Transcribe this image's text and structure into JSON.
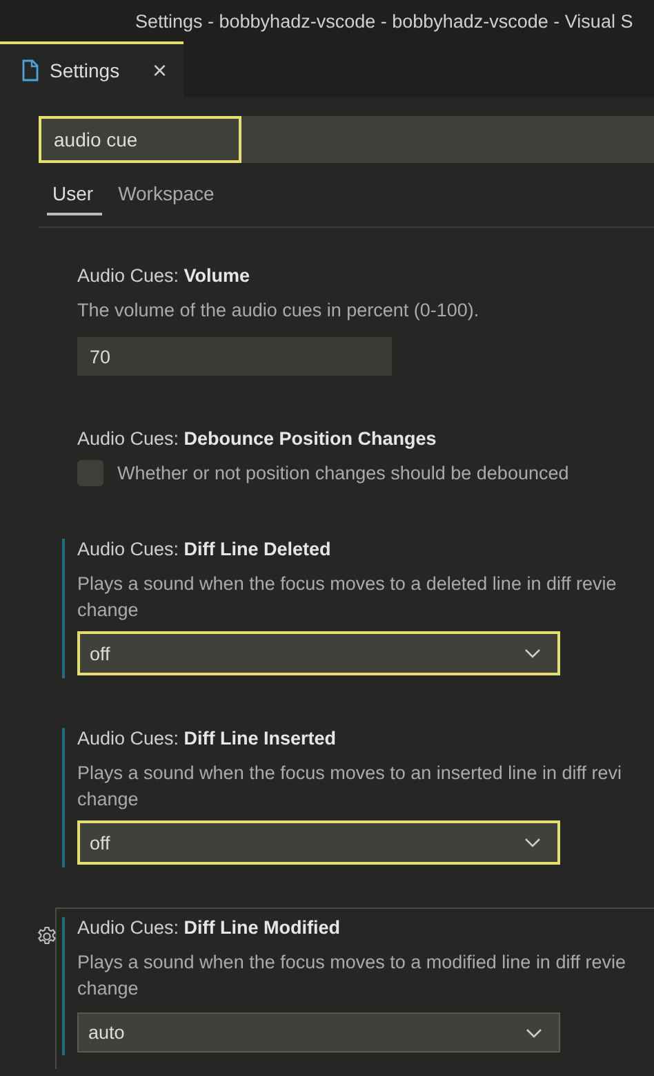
{
  "window": {
    "title": "Settings - bobbyhadz-vscode - bobbyhadz-vscode - Visual S"
  },
  "tabs": [
    {
      "label": "Settings",
      "selected": true,
      "close": "×"
    }
  ],
  "search": {
    "value": "audio cue",
    "highlighted": true
  },
  "scope_tabs": [
    {
      "label": "User",
      "selected": true
    },
    {
      "label": "Workspace",
      "selected": false
    }
  ],
  "settings": [
    {
      "kind": "number",
      "category": "Audio Cues:",
      "title": "Volume",
      "description": [
        "The volume of the audio cues in percent (0-100)."
      ],
      "value": "70",
      "modified": false,
      "highlighted": false,
      "hovered": false
    },
    {
      "kind": "checkbox",
      "category": "Audio Cues:",
      "title": "Debounce Position Changes",
      "description": [
        "Whether or not position changes should be debounced"
      ],
      "checked": false,
      "modified": false,
      "highlighted": false,
      "hovered": false
    },
    {
      "kind": "select",
      "category": "Audio Cues:",
      "title": "Diff Line Deleted",
      "description": [
        "Plays a sound when the focus moves to a deleted line in diff revie",
        "change"
      ],
      "value": "off",
      "modified": true,
      "highlighted": true,
      "hovered": false
    },
    {
      "kind": "select",
      "category": "Audio Cues:",
      "title": "Diff Line Inserted",
      "description": [
        "Plays a sound when the focus moves to an inserted line in diff revi",
        "change"
      ],
      "value": "off",
      "modified": true,
      "highlighted": true,
      "hovered": false
    },
    {
      "kind": "select",
      "category": "Audio Cues:",
      "title": "Diff Line Modified",
      "description": [
        "Plays a sound when the focus moves to a modified line in diff revie",
        "change"
      ],
      "value": "auto",
      "modified": true,
      "highlighted": false,
      "hovered": true
    }
  ]
}
